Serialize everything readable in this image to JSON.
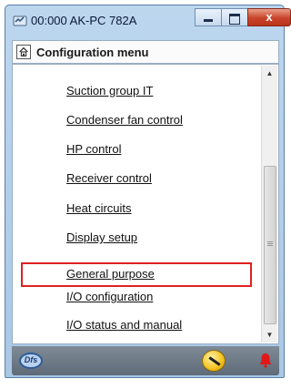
{
  "window": {
    "title": "00:000 AK-PC 782A",
    "controls": {
      "minimize": "–",
      "maximize": "□",
      "close": "x"
    }
  },
  "header": {
    "title": "Configuration menu",
    "icon": "home-icon"
  },
  "menu": {
    "items": [
      "Suction group IT",
      "Condenser fan control",
      "HP control",
      "Receiver control",
      "Heat circuits",
      "Display setup",
      "General purpose",
      "I/O configuration",
      "I/O status and manual"
    ],
    "highlighted_index": 6
  },
  "footer": {
    "logo_text": "Dfs",
    "tool_icon": "wrench-icon",
    "alarm_icon": "bell-icon"
  },
  "colors": {
    "title_bar": "#bcd6ee",
    "close_button": "#c8432a",
    "highlight": "#e02020",
    "bottom_bar": "#6f7b88",
    "alarm": "#e01818"
  }
}
